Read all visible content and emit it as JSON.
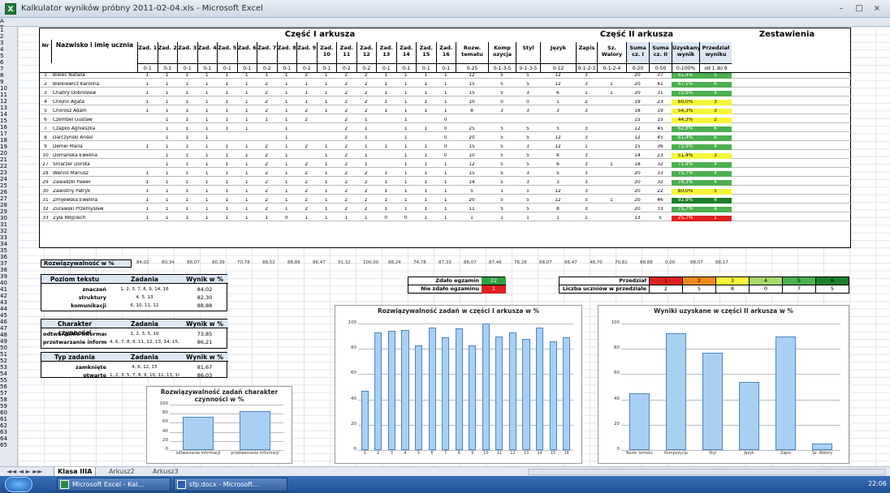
{
  "window": {
    "title": "Kalkulator wyników próbny 2011-02-04.xls - Microsoft Excel",
    "min": "–",
    "max": "□",
    "close": "×"
  },
  "columns": [
    "A",
    "B",
    "C",
    "D",
    "E",
    "F",
    "G",
    "H",
    "I",
    "J",
    "K",
    "L",
    "M",
    "N",
    "O",
    "P",
    "Q",
    "R",
    "S",
    "T",
    "U",
    "V",
    "W",
    "X",
    "Y",
    "Z",
    "AA",
    "AB",
    "AC"
  ],
  "rows": [
    "1",
    "2",
    "3",
    "4",
    "5",
    "6",
    "7",
    "8",
    "9",
    "10",
    "11",
    "12",
    "13",
    "14",
    "15",
    "16",
    "17",
    "18",
    "19",
    "20",
    "21",
    "22",
    "23",
    "24",
    "25",
    "26",
    "27",
    "28",
    "29",
    "30",
    "31",
    "32",
    "33",
    "34",
    "35",
    "36",
    "37",
    "38",
    "39",
    "40",
    "41",
    "42",
    "43",
    "44",
    "45",
    "46",
    "47",
    "48",
    "49",
    "50",
    "51",
    "52",
    "53",
    "54",
    "55",
    "56",
    "57",
    "58",
    "59",
    "60",
    "61",
    "62",
    "63",
    "64",
    "65"
  ],
  "header": {
    "part1": "Część I arkusza",
    "part2": "Część II arkusza",
    "summary": "Zestawienia",
    "nr": "Nr",
    "name": "Nazwisko i imię ucznia",
    "cols": [
      {
        "l": "Zad. 1",
        "r": "0-1"
      },
      {
        "l": "Zad. 2",
        "r": "0-1"
      },
      {
        "l": "Zad. 3",
        "r": "0-1"
      },
      {
        "l": "Zad. 4",
        "r": "0-1"
      },
      {
        "l": "Zad. 5",
        "r": "0-1"
      },
      {
        "l": "Zad. 6",
        "r": "0-1"
      },
      {
        "l": "Zad. 7",
        "r": "0-2"
      },
      {
        "l": "Zad. 8",
        "r": "0-1"
      },
      {
        "l": "Zad. 9",
        "r": "0-2"
      },
      {
        "l": "Zad. 10",
        "r": "0-1"
      },
      {
        "l": "Zad. 11",
        "r": "0-2"
      },
      {
        "l": "Zad. 12",
        "r": "0-2"
      },
      {
        "l": "Zad. 13",
        "r": "0-1"
      },
      {
        "l": "Zad. 14",
        "r": "0-1"
      },
      {
        "l": "Zad. 15",
        "r": "0-1"
      },
      {
        "l": "Zad. 16",
        "r": "0-1"
      }
    ],
    "cols2": [
      {
        "l": "Rozw. tematu",
        "r": "0-25"
      },
      {
        "l": "Komp ozycja",
        "r": "0-1-3-5"
      },
      {
        "l": "Styl",
        "r": "0-1-3-5"
      },
      {
        "l": "Język",
        "r": "0-12"
      },
      {
        "l": "Zapis",
        "r": "0-1-2-3"
      },
      {
        "l": "Sz. Walory",
        "r": "0-1-2-4"
      }
    ],
    "cols3": [
      {
        "l": "Suma cz. I",
        "r": "0-20"
      },
      {
        "l": "Suma cz. II",
        "r": "0-50"
      },
      {
        "l": "Uzyskany wynik",
        "r": "0-100%"
      },
      {
        "l": "Przedział wyniku",
        "r": "od 1 do 9"
      }
    ]
  },
  "students": [
    {
      "nr": "1",
      "name": "Bieleć Natalia",
      "p1": [
        "1",
        "1",
        "1",
        "1",
        "1",
        "1",
        "1",
        "1",
        "2",
        "1",
        "2",
        "2",
        "1",
        "1",
        "1",
        "1"
      ],
      "p2": [
        "12",
        "5",
        "5",
        "12",
        "3",
        ""
      ],
      "s1": "20",
      "s2": "37",
      "pct": "61,4%",
      "band": "5",
      "c": "#4caf50"
    },
    {
      "nr": "2",
      "name": "Bielkiewicz Karolina",
      "p1": [
        "1",
        "1",
        "1",
        "1",
        "1",
        "1",
        "2",
        "1",
        "1",
        "1",
        "2",
        "2",
        "1",
        "1",
        "1",
        "1"
      ],
      "p2": [
        "15",
        "5",
        "5",
        "12",
        "3",
        "1"
      ],
      "s1": "20",
      "s2": "41",
      "pct": "67,1%",
      "band": "6",
      "c": "#4caf50"
    },
    {
      "nr": "3",
      "name": "Chabry Dobrosław",
      "p1": [
        "1",
        "1",
        "1",
        "1",
        "1",
        "1",
        "2",
        "1",
        "1",
        "1",
        "2",
        "2",
        "1",
        "1",
        "1",
        "1"
      ],
      "p2": [
        "15",
        "5",
        "3",
        "6",
        "1",
        "1"
      ],
      "s1": "20",
      "s2": "31",
      "pct": "72,9%",
      "band": "4",
      "c": "#4caf50"
    },
    {
      "nr": "4",
      "name": "Chojno Agata",
      "p1": [
        "1",
        "1",
        "1",
        "1",
        "1",
        "1",
        "2",
        "1",
        "1",
        "1",
        "2",
        "2",
        "1",
        "1",
        "1",
        "1"
      ],
      "p2": [
        "10",
        "0",
        "0",
        "1",
        "2",
        ""
      ],
      "s1": "19",
      "s2": "23",
      "pct": "60,0%",
      "band": "3",
      "c": "#f5f53a"
    },
    {
      "nr": "5",
      "name": "Chorosz Adam",
      "p1": [
        "1",
        "1",
        "1",
        "1",
        "1",
        "1",
        "2",
        "1",
        "2",
        "1",
        "2",
        "2",
        "1",
        "1",
        "1",
        "1"
      ],
      "p2": [
        "8",
        "3",
        "3",
        "3",
        "3",
        ""
      ],
      "s1": "18",
      "s2": "19",
      "pct": "54,3%",
      "band": "3",
      "c": "#f5f53a"
    },
    {
      "nr": "6",
      "name": "Czembel Gustaw",
      "p1": [
        "",
        "1",
        "1",
        "1",
        "1",
        "1",
        "1",
        "1",
        "2",
        "",
        "2",
        "1",
        "",
        "1",
        "",
        "0"
      ],
      "p2": [
        "",
        "",
        "",
        "",
        "",
        ""
      ],
      "s1": "15",
      "s2": "15",
      "pct": "44,3%",
      "band": "2",
      "c": "#f5f53a"
    },
    {
      "nr": "7",
      "name": "Czapko Agnieszka",
      "p1": [
        "",
        "1",
        "1",
        "1",
        "1",
        "1",
        "",
        "1",
        "",
        "",
        "2",
        "1",
        "",
        "1",
        "1",
        "0"
      ],
      "p2": [
        "25",
        "5",
        "5",
        "5",
        "3",
        ""
      ],
      "s1": "12",
      "s2": "45",
      "pct": "62,8%",
      "band": "6",
      "c": "#4caf50"
    },
    {
      "nr": "8",
      "name": "Darczyński Ansel",
      "p1": [
        "",
        "1",
        "1",
        "1",
        "",
        "",
        "",
        "1",
        "",
        "",
        "2",
        "1",
        "",
        "1",
        "",
        "0"
      ],
      "p2": [
        "20",
        "5",
        "5",
        "12",
        "3",
        ""
      ],
      "s1": "12",
      "s2": "45",
      "pct": "81,4%",
      "band": "6",
      "c": "#4caf50"
    },
    {
      "nr": "9",
      "name": "Demel Maria",
      "p1": [
        "1",
        "1",
        "1",
        "1",
        "1",
        "1",
        "2",
        "1",
        "2",
        "1",
        "2",
        "1",
        "1",
        "1",
        "1",
        "0"
      ],
      "p2": [
        "15",
        "5",
        "3",
        "12",
        "1",
        ""
      ],
      "s1": "15",
      "s2": "36",
      "pct": "72,9%",
      "band": "4",
      "c": "#4caf50"
    },
    {
      "nr": "10",
      "name": "Domańska Ewelina",
      "p1": [
        "",
        "1",
        "1",
        "1",
        "1",
        "1",
        "2",
        "1",
        "",
        "1",
        "2",
        "1",
        "",
        "1",
        "1",
        "0"
      ],
      "p2": [
        "10",
        "5",
        "5",
        "8",
        "3",
        ""
      ],
      "s1": "14",
      "s2": "23",
      "pct": "51,4%",
      "band": "3",
      "c": "#f5f53a"
    },
    {
      "nr": "27",
      "name": "Smarzer Dorota",
      "p1": [
        "",
        "1",
        "1",
        "1",
        "1",
        "1",
        "2",
        "1",
        "2",
        "1",
        "2",
        "1",
        "",
        "1",
        "1",
        "1"
      ],
      "p2": [
        "12",
        "5",
        "5",
        "6",
        "3",
        "1"
      ],
      "s1": "18",
      "s2": "32",
      "pct": "71,4%",
      "band": "4",
      "c": "#4caf50"
    },
    {
      "nr": "28",
      "name": "Wenno Mariusz",
      "p1": [
        "1",
        "1",
        "1",
        "1",
        "1",
        "1",
        "2",
        "1",
        "2",
        "1",
        "2",
        "2",
        "1",
        "1",
        "1",
        "1"
      ],
      "p2": [
        "15",
        "5",
        "3",
        "5",
        "3",
        ""
      ],
      "s1": "20",
      "s2": "33",
      "pct": "75,7%",
      "band": "4",
      "c": "#4caf50"
    },
    {
      "nr": "29",
      "name": "Zawadzki Paweł",
      "p1": [
        "1",
        "1",
        "1",
        "1",
        "1",
        "1",
        "2",
        "1",
        "2",
        "1",
        "2",
        "2",
        "1",
        "1",
        "1",
        "1"
      ],
      "p2": [
        "14",
        "5",
        "3",
        "3",
        "3",
        ""
      ],
      "s1": "20",
      "s2": "32",
      "pct": "74,3%",
      "band": "4",
      "c": "#4caf50"
    },
    {
      "nr": "30",
      "name": "Zawistny Patryk",
      "p1": [
        "1",
        "1",
        "1",
        "1",
        "1",
        "1",
        "2",
        "1",
        "2",
        "1",
        "2",
        "2",
        "1",
        "1",
        "1",
        "1"
      ],
      "p2": [
        "5",
        "1",
        "1",
        "12",
        "3",
        ""
      ],
      "s1": "20",
      "s2": "22",
      "pct": "80,0%",
      "band": "5",
      "c": "#f5f53a"
    },
    {
      "nr": "31",
      "name": "Żmijewska Ewelina",
      "p1": [
        "1",
        "1",
        "1",
        "1",
        "1",
        "1",
        "2",
        "1",
        "2",
        "1",
        "2",
        "2",
        "1",
        "1",
        "1",
        "1"
      ],
      "p2": [
        "20",
        "5",
        "5",
        "12",
        "3",
        "1"
      ],
      "s1": "20",
      "s2": "46",
      "pct": "92,9%",
      "band": "8",
      "c": "#1b7e2b"
    },
    {
      "nr": "32",
      "name": "Żurawski Przemysław",
      "p1": [
        "1",
        "1",
        "1",
        "1",
        "1",
        "1",
        "2",
        "1",
        "2",
        "1",
        "2",
        "2",
        "1",
        "1",
        "1",
        "1"
      ],
      "p2": [
        "11",
        "5",
        "5",
        "8",
        "3",
        ""
      ],
      "s1": "20",
      "s2": "33",
      "pct": "75,7%",
      "band": "4",
      "c": "#4caf50"
    },
    {
      "nr": "33",
      "name": "Żyła Wojciech",
      "p1": [
        "1",
        "1",
        "1",
        "1",
        "1",
        "1",
        "1",
        "0",
        "1",
        "1",
        "1",
        "1",
        "0",
        "0",
        "1",
        "1"
      ],
      "p2": [
        "1",
        "1",
        "1",
        "1",
        "1",
        ""
      ],
      "s1": "13",
      "s2": "5",
      "pct": "25,7%",
      "band": "1",
      "c": "#e02020"
    }
  ],
  "solv": {
    "label": "Rozwiązywalność w %",
    "values": [
      "84,02",
      "80,34",
      "88,07",
      "80,39",
      "70,78",
      "88,52",
      "88,88",
      "86,47",
      "91,32",
      "100,00",
      "88,24",
      "74,78",
      "87,33",
      "88,07",
      "87,46",
      "76,28",
      "68,07",
      "88,47",
      "48,70",
      "70,81",
      "88,88",
      "0,00",
      "88,07",
      "88,17"
    ]
  },
  "skills": {
    "h1": "Poziom tekstu",
    "h2": "Zadania",
    "h3": "Wynik w %",
    "rows": [
      {
        "a": "znaczeń",
        "b": "1, 2, 3, 7, 8, 9, 14, 16",
        "c": "84,02"
      },
      {
        "a": "struktury",
        "b": "4, 5, 13",
        "c": "82,30"
      },
      {
        "a": "komunikacji",
        "b": "6, 10, 11, 12",
        "c": "88,88"
      }
    ]
  },
  "activity": {
    "h1": "Charakter czynności",
    "h2": "Zadania",
    "h3": "Wynik w %",
    "rows": [
      {
        "a": "odtwarzanie informacji",
        "b": "1, 2, 3, 5, 10",
        "c": "73,85"
      },
      {
        "a": "przetwarzanie informacji",
        "b": "4, 6, 7, 8, 9, 11, 12, 13, 14, 15, 16",
        "c": "86,21"
      }
    ]
  },
  "tasktype": {
    "h1": "Typ zadania",
    "h2": "Zadania",
    "h3": "Wynik w %",
    "rows": [
      {
        "a": "zamknięte",
        "b": "4, 6, 12, 15",
        "c": "81,67"
      },
      {
        "a": "otwarte",
        "b": "1, 2, 3, 5, 7, 8, 9, 10, 11, 13, 14, 16",
        "c": "86,03"
      }
    ]
  },
  "exam": {
    "took": "Zdało egzamin",
    "took_val": "22",
    "fail": "Nie zdało egzaminu",
    "fail_val": "1"
  },
  "bands": {
    "label": "Przedział",
    "count_label": "Liczba uczniów w przedziale",
    "items": [
      {
        "n": "1",
        "v": "2",
        "c": "#e02020"
      },
      {
        "n": "2",
        "v": "5",
        "c": "#f08a1a"
      },
      {
        "n": "3",
        "v": "8",
        "c": "#f5f53a"
      },
      {
        "n": "4",
        "v": "0",
        "c": "#a6d86a"
      },
      {
        "n": "5",
        "v": "7",
        "c": "#4caf50"
      },
      {
        "n": "6",
        "v": "5",
        "c": "#1b7e2b"
      }
    ]
  },
  "charts": [
    {
      "title": "Rozwiązywalność zadań charakter czynności w %",
      "ylim": [
        0,
        100
      ],
      "yticks": [
        "100",
        "80",
        "60",
        "40",
        "20",
        "0"
      ],
      "categories": [
        "odtwarzanie informacji",
        "przetwarzanie informacji"
      ],
      "values": [
        73.85,
        86.21
      ]
    },
    {
      "title": "Rozwiązywalność zadań w części I arkusza w %",
      "ylim": [
        0,
        100
      ],
      "yticks": [
        "100",
        "80",
        "60",
        "40",
        "20",
        "0"
      ],
      "categories": [
        "1",
        "2",
        "3",
        "4",
        "5",
        "6",
        "7",
        "8",
        "9",
        "10",
        "11",
        "12",
        "13",
        "14",
        "15",
        "16"
      ],
      "values": [
        47,
        93,
        94,
        95,
        83,
        97,
        89,
        96,
        83,
        100,
        90,
        93,
        88,
        97,
        86,
        89
      ]
    },
    {
      "title": "Wyniki uzyskane w części II arkusza w %",
      "ylim": [
        0,
        100
      ],
      "yticks": [
        "100",
        "80",
        "60",
        "40",
        "20",
        "0"
      ],
      "categories": [
        "Rozw. tematu",
        "Kompozycja",
        "Styl",
        "Język",
        "Zapis",
        "Sz. Walory"
      ],
      "values": [
        45,
        92,
        77,
        54,
        90,
        5
      ]
    }
  ],
  "tabs": {
    "active": "Klasa IIIA",
    "t2": "Arkusz2",
    "t3": "Arkusz3"
  },
  "taskbar": {
    "app1": "Microsoft Excel - Kal...",
    "app2": "sfp.docx - Microsoft...",
    "time": "22:06"
  }
}
